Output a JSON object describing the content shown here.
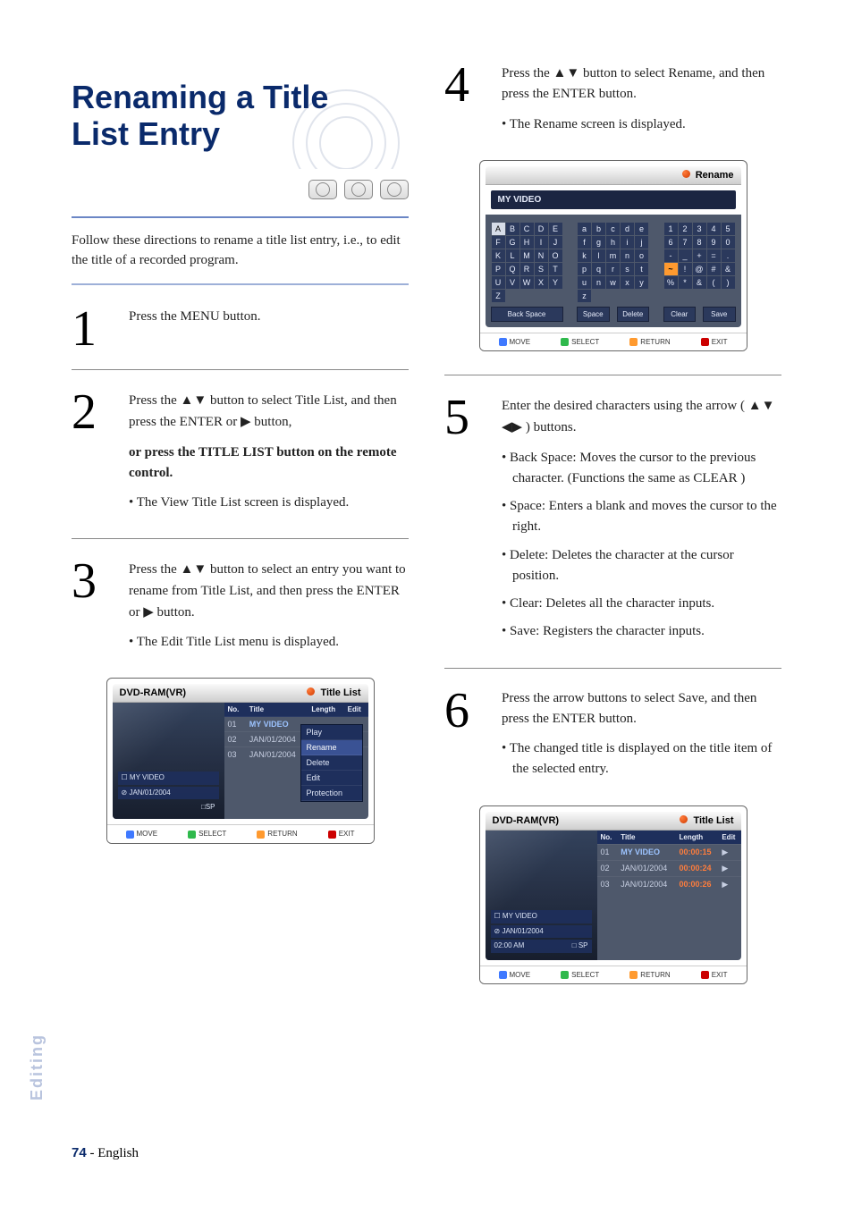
{
  "title": "Renaming a Title List Entry",
  "intro": "Follow these directions to rename a title list entry, i.e., to edit the title of a recorded program.",
  "steps": {
    "s1": {
      "num": "1",
      "text": "Press the MENU button."
    },
    "s2": {
      "num": "2",
      "p1_a": "Press the ",
      "p1_b": " button to select Title List, and then press the ENTER or ",
      "p1_c": " button,",
      "p2": "or press the TITLE LIST button on the remote control.",
      "b1": "The View Title List screen is displayed."
    },
    "s3": {
      "num": "3",
      "p1_a": "Press the ",
      "p1_b": " button to select an entry you want to rename from Title List, and then press the ENTER or ",
      "p1_c": " button.",
      "b1": "The Edit Title List menu is displayed."
    },
    "s4": {
      "num": "4",
      "p1_a": "Press the ",
      "p1_b": " button to select Rename, and then press the ENTER button.",
      "b1": "The Rename screen is displayed."
    },
    "s5": {
      "num": "5",
      "p1_a": "Enter the desired characters using the arrow ( ",
      "p1_b": " ) buttons.",
      "b1": "Back Space: Moves the cursor to the previous character. (Functions the same as CLEAR )",
      "b2": "Space: Enters a blank and moves the cursor to the right.",
      "b3": "Delete: Deletes the character at the cursor position.",
      "b4": "Clear: Deletes all the character inputs.",
      "b5": "Save: Registers the character inputs."
    },
    "s6": {
      "num": "6",
      "p1": "Press the arrow buttons to select Save, and then press the ENTER button.",
      "b1": "The changed title is displayed on the title item of the selected entry."
    }
  },
  "ui1": {
    "header_left": "DVD-RAM(VR)",
    "header_right": "Title List",
    "th_no": "No.",
    "th_title": "Title",
    "th_length": "Length",
    "th_edit": "Edit",
    "rows": [
      {
        "no": "01",
        "title": "MY VIDEO"
      },
      {
        "no": "02",
        "title": "JAN/01/2004"
      },
      {
        "no": "03",
        "title": "JAN/01/2004"
      }
    ],
    "ctx": [
      "Play",
      "Rename",
      "Delete",
      "Edit",
      "Protection"
    ],
    "thumb_title_label": "MY VIDEO",
    "thumb_date": "JAN/01/2004",
    "thumb_sp": "SP",
    "ftr": {
      "move": "MOVE",
      "select": "SELECT",
      "return": "RETURN",
      "exit": "EXIT"
    }
  },
  "uiRename": {
    "header_right": "Rename",
    "field": "MY VIDEO",
    "upper": [
      [
        "A",
        "B",
        "C",
        "D",
        "E"
      ],
      [
        "F",
        "G",
        "H",
        "I",
        "J"
      ],
      [
        "K",
        "L",
        "M",
        "N",
        "O"
      ],
      [
        "P",
        "Q",
        "R",
        "S",
        "T"
      ],
      [
        "U",
        "V",
        "W",
        "X",
        "Y"
      ],
      [
        "Z",
        "",
        "",
        "",
        ""
      ]
    ],
    "lower": [
      [
        "a",
        "b",
        "c",
        "d",
        "e"
      ],
      [
        "f",
        "g",
        "h",
        "i",
        "j"
      ],
      [
        "k",
        "l",
        "m",
        "n",
        "o"
      ],
      [
        "p",
        "q",
        "r",
        "s",
        "t"
      ],
      [
        "u",
        "n",
        "w",
        "x",
        "y"
      ],
      [
        "z",
        "",
        "",
        "",
        ""
      ]
    ],
    "nums": [
      [
        "1",
        "2",
        "3",
        "4",
        "5"
      ],
      [
        "6",
        "7",
        "8",
        "9",
        "0"
      ],
      [
        "-",
        "_",
        "+",
        "=",
        "."
      ],
      [
        "~",
        "!",
        "@",
        "#",
        "&"
      ],
      [
        "%",
        "*",
        "&",
        "(",
        ")"
      ],
      [
        "",
        "",
        "",
        "",
        ""
      ]
    ],
    "btns_l": "Back Space",
    "btns_m1": "Space",
    "btns_m2": "Delete",
    "btns_r1": "Clear",
    "btns_r2": "Save",
    "ftr": {
      "move": "MOVE",
      "select": "SELECT",
      "return": "RETURN",
      "exit": "EXIT"
    }
  },
  "ui3": {
    "header_left": "DVD-RAM(VR)",
    "header_right": "Title List",
    "th_no": "No.",
    "th_title": "Title",
    "th_length": "Length",
    "th_edit": "Edit",
    "rows": [
      {
        "no": "01",
        "title": "MY VIDEO",
        "len": "00:00:15"
      },
      {
        "no": "02",
        "title": "JAN/01/2004",
        "len": "00:00:24"
      },
      {
        "no": "03",
        "title": "JAN/01/2004",
        "len": "00:00:26"
      }
    ],
    "thumb_title_label": "MY VIDEO",
    "thumb_date": "JAN/01/2004",
    "thumb_time": "02:00 AM",
    "thumb_sp": "SP",
    "ftr": {
      "move": "MOVE",
      "select": "SELECT",
      "return": "RETURN",
      "exit": "EXIT"
    }
  },
  "side_tab": "Editing",
  "footer_page": "74",
  "footer_lang": "English"
}
